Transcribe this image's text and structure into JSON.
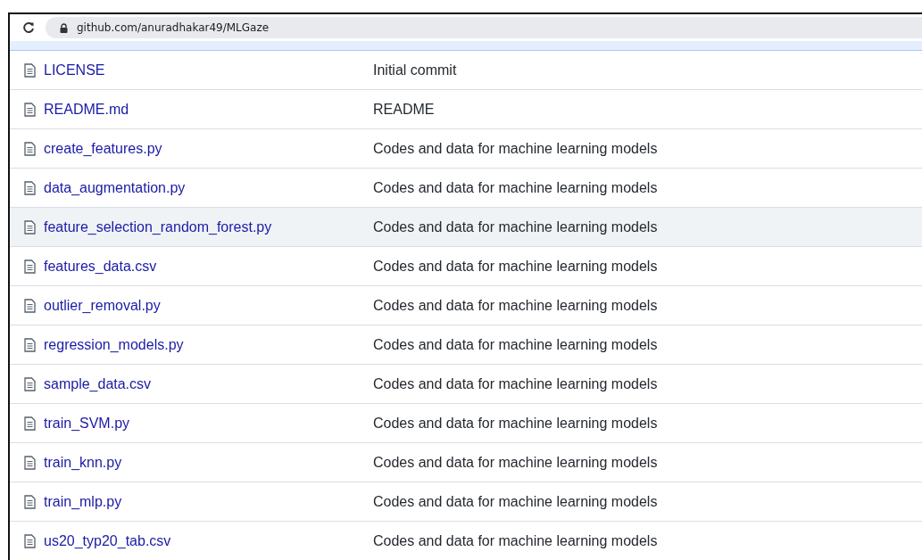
{
  "address_bar": {
    "url": "github.com/anuradhakar49/MLGaze"
  },
  "files": [
    {
      "name": "LICENSE",
      "message": "Initial commit",
      "selected": false
    },
    {
      "name": "README.md",
      "message": "README",
      "selected": false
    },
    {
      "name": "create_features.py",
      "message": "Codes and data for machine learning models",
      "selected": false
    },
    {
      "name": "data_augmentation.py",
      "message": "Codes and data for machine learning models",
      "selected": false
    },
    {
      "name": "feature_selection_random_forest.py",
      "message": "Codes and data for machine learning models",
      "selected": true
    },
    {
      "name": "features_data.csv",
      "message": "Codes and data for machine learning models",
      "selected": false
    },
    {
      "name": "outlier_removal.py",
      "message": "Codes and data for machine learning models",
      "selected": false
    },
    {
      "name": "regression_models.py",
      "message": "Codes and data for machine learning models",
      "selected": false
    },
    {
      "name": "sample_data.csv",
      "message": "Codes and data for machine learning models",
      "selected": false
    },
    {
      "name": "train_SVM.py",
      "message": "Codes and data for machine learning models",
      "selected": false
    },
    {
      "name": "train_knn.py",
      "message": "Codes and data for machine learning models",
      "selected": false
    },
    {
      "name": "train_mlp.py",
      "message": "Codes and data for machine learning models",
      "selected": false
    },
    {
      "name": "us20_typ20_tab.csv",
      "message": "Codes and data for machine learning models",
      "selected": false
    }
  ]
}
